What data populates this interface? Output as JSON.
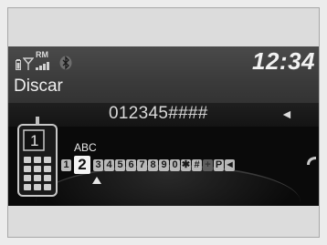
{
  "status": {
    "signal_label": "RM"
  },
  "clock": "12:34",
  "title": "Discar",
  "dial": {
    "number": "012345####",
    "backspace_glyph": "◄"
  },
  "phone": {
    "slot": "1"
  },
  "keypad": {
    "letters": "ABC",
    "keys": [
      "1",
      "2",
      "3",
      "4",
      "5",
      "6",
      "7",
      "8",
      "9",
      "0",
      "✱",
      "#",
      "+",
      "P"
    ],
    "selected": "2",
    "backspace_key": "◄"
  },
  "colors": {
    "screen_bg": "#0a0a0a",
    "header_bg": "#3b3b3b",
    "text": "#eeeeee"
  }
}
